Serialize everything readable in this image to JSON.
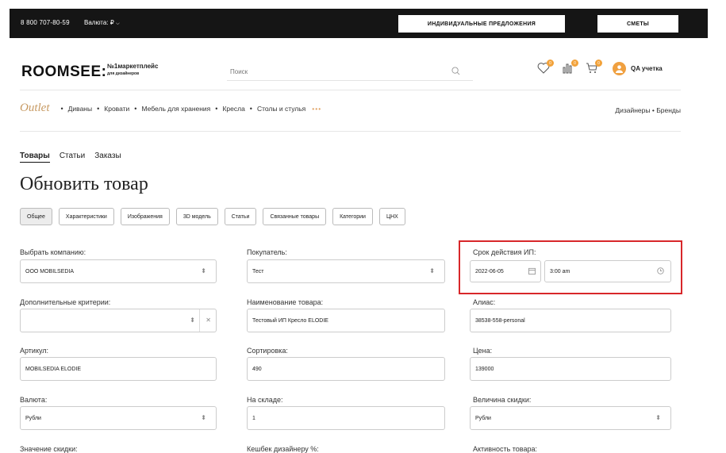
{
  "topbar": {
    "phone": "8 800 707-80-59",
    "currency": "Валюта: ₽",
    "offers_button": "ИНДИВИДУАЛЬНЫЕ ПРЕДЛОЖЕНИЯ",
    "estimates_button": "СМЕТЫ"
  },
  "header": {
    "logo": "ROOMSEE:",
    "logo_tag": "№1маркетплейс",
    "logo_tag2": "для дизайнеров",
    "search_placeholder": "Поиск",
    "badges": {
      "favorites": "0",
      "compare": "0",
      "cart": "0"
    },
    "account": "QA учетка"
  },
  "nav": {
    "outlet": "Outlet",
    "items": [
      "Диваны",
      "Кровати",
      "Мебель для хранения",
      "Кресла",
      "Столы и стулья"
    ],
    "more": "•••",
    "right": "Дизайнеры • Бренды"
  },
  "tabs": [
    "Товары",
    "Статьи",
    "Заказы"
  ],
  "page_title": "Обновить товар",
  "subtabs": [
    "Общее",
    "Характеристики",
    "Изображения",
    "3D модель",
    "Статьи",
    "Связанные товары",
    "Категории",
    "ЦНХ"
  ],
  "form": {
    "company_label": "Выбрать компанию:",
    "company_value": "ООО MOBILSEDIA",
    "buyer_label": "Покупатель:",
    "buyer_value": "Тест",
    "validity_label": "Срок действия ИП:",
    "validity_date": "2022-06-05",
    "validity_time": "3:00 am",
    "criteria_label": "Дополнительные критерии:",
    "criteria_value": "",
    "name_label": "Наименование товара:",
    "name_value": "Тестовый ИП Кресло ELODIE",
    "alias_label": "Алиас:",
    "alias_value": "38538-558-personal",
    "sku_label": "Артикул:",
    "sku_value": "MOBILSEDIA ELODIE",
    "sort_label": "Сортировка:",
    "sort_value": "490",
    "price_label": "Цена:",
    "price_value": "139000",
    "currency_label": "Валюта:",
    "currency_value": "Рубли",
    "stock_label": "На складе:",
    "stock_value": "1",
    "discount_label": "Величина скидки:",
    "discount_value": "Рубли",
    "discount_amount_label": "Значение скидки:",
    "cashback_label": "Кешбек дизайнеру %:",
    "active_label": "Активность товара:"
  },
  "colors": {
    "accent": "#c79a63",
    "badge": "#f2a23a",
    "highlight": "#d8272a",
    "topbar": "#151515"
  }
}
